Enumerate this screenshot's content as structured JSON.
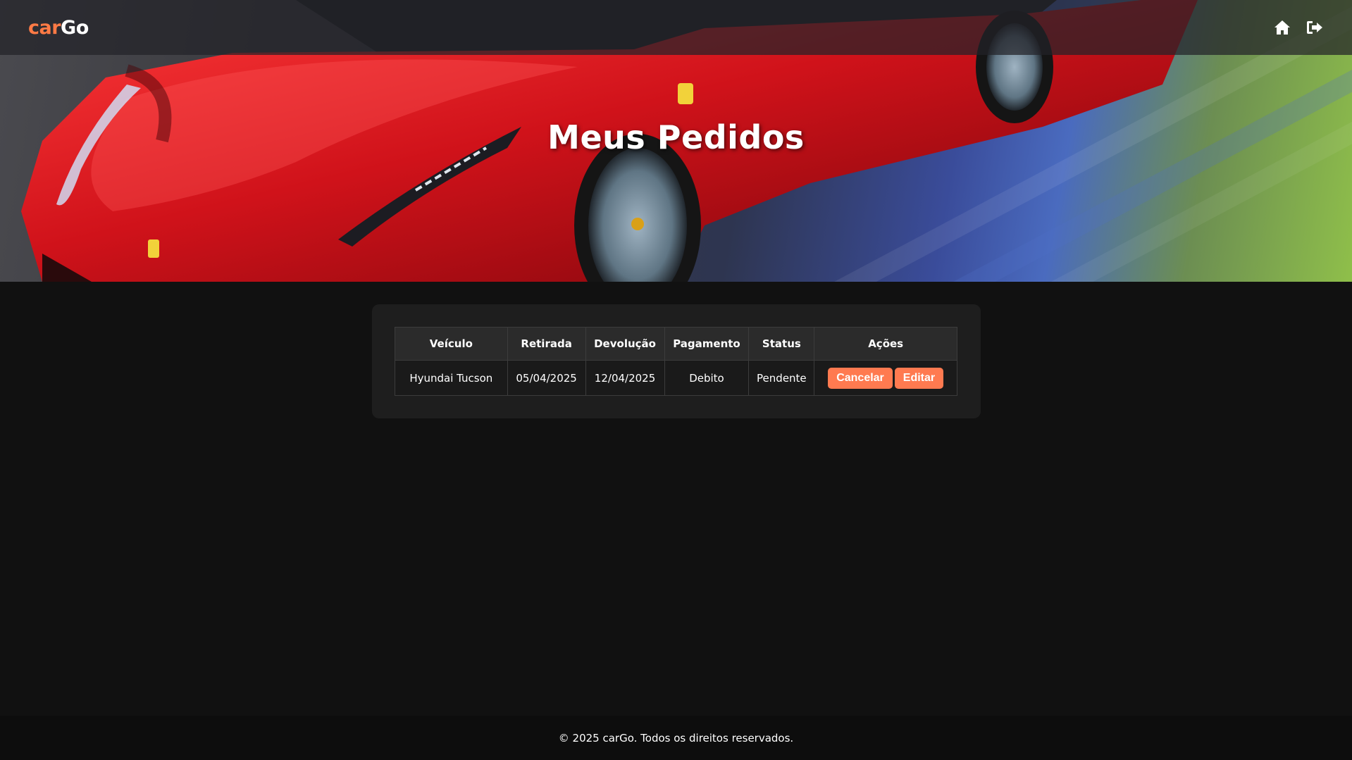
{
  "brand": {
    "part1": "car",
    "part2": "Go",
    "accent": "#ff7a45"
  },
  "nav": {
    "icons": [
      "home-icon",
      "logout-icon"
    ]
  },
  "hero": {
    "title": "Meus Pedidos"
  },
  "orders": {
    "headers": {
      "vehicle": "Veículo",
      "pickup": "Retirada",
      "return": "Devolução",
      "payment": "Pagamento",
      "status": "Status",
      "actions": "Ações"
    },
    "rows": [
      {
        "vehicle": "Hyundai Tucson",
        "pickup": "05/04/2025",
        "return": "12/04/2025",
        "payment": "Debito",
        "status": "Pendente",
        "cancel_label": "Cancelar",
        "edit_label": "Editar"
      }
    ]
  },
  "footer": {
    "text": "© 2025 carGo. Todos os direitos reservados."
  },
  "colors": {
    "background": "#111111",
    "button": "#ff7a50",
    "card": "#1e1e1e"
  }
}
